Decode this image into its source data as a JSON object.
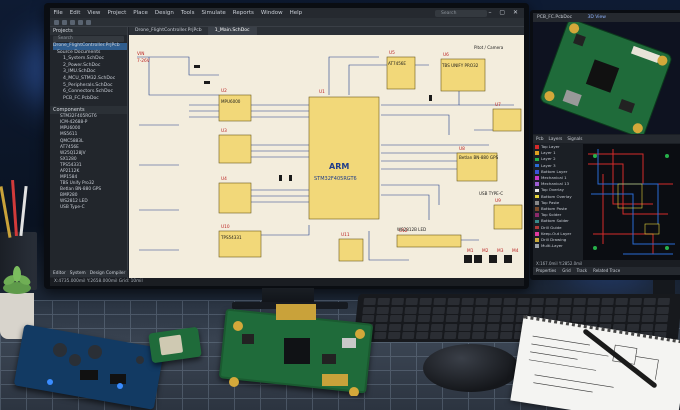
{
  "menu": [
    "File",
    "Edit",
    "View",
    "Project",
    "Place",
    "Design",
    "Tools",
    "Simulate",
    "Reports",
    "Window",
    "Help"
  ],
  "search": {
    "placeholder": "Search"
  },
  "doc_tabs": [
    "Drone_FlightController.PrjPcb",
    "1_Main.SchDoc"
  ],
  "projects_panel": {
    "title": "Projects",
    "search_placeholder": "Search",
    "tree": [
      "Drone_FlightController.PrjPcb",
      "Source Documents",
      "1_System.SchDoc",
      "2_Power.SchDoc",
      "3_IMU.SchDoc",
      "4_MCU_STM32.SchDoc",
      "5_Peripherals.SchDoc",
      "6_Connectors.SchDoc",
      "PCB_FC.PcbDoc"
    ]
  },
  "components_panel": {
    "title": "Components",
    "items": [
      "STM32F405RGT6",
      "ICM-42688-P",
      "MPU6000",
      "MS5611",
      "QMC5883L",
      "AT7456E",
      "W25Q128JV",
      "SX1280",
      "TPS54331",
      "AP2112K",
      "MP1584",
      "TBS Unify Pro32",
      "Betlan BN-880 GPS",
      "BMP280",
      "WS2812 LED",
      "USB Type-C"
    ]
  },
  "panel_tabs": [
    "Editor",
    "System",
    "Design Compiler"
  ],
  "statusbar": "X:4735.000mil Y:2658.000mil   Grid: 10mil",
  "schematic": {
    "main_ic": {
      "ref": "U1",
      "brand": "ARM",
      "part": "STM32F405RGT6"
    },
    "vin": "VIN",
    "vin_voltage": "7-26V",
    "labels": [
      "U2",
      "U3",
      "U4",
      "U5",
      "U6",
      "U7",
      "U8",
      "U9",
      "U10",
      "U11",
      "U12",
      "AT7456E",
      "TBS UNIFY PRO32",
      "MPU6000",
      "Pitot / Camera",
      "Betlan BN-880 GPS",
      "USB TYPE-C",
      "WS2812B LED",
      "TPS54331",
      "M1",
      "M2",
      "M3",
      "M4"
    ]
  },
  "monitor2": {
    "tabs": [
      "PCB_FC.PcbDoc",
      "3D View"
    ],
    "panel_tabs": [
      "Pcb",
      "Layers",
      "Signals"
    ],
    "layers": [
      {
        "name": "Top Layer",
        "color": "#d42a2a"
      },
      {
        "name": "Layer 1",
        "color": "#e0a020"
      },
      {
        "name": "Layer 2",
        "color": "#26b14a"
      },
      {
        "name": "Layer 3",
        "color": "#2a6ad4"
      },
      {
        "name": "Bottom Layer",
        "color": "#3a55d8"
      },
      {
        "name": "Mechanical 1",
        "color": "#c838c8"
      },
      {
        "name": "Mechanical 13",
        "color": "#9b5dd1"
      },
      {
        "name": "Top Overlay",
        "color": "#e8e8e8"
      },
      {
        "name": "Bottom Overlay",
        "color": "#e3d33a"
      },
      {
        "name": "Top Paste",
        "color": "#888888"
      },
      {
        "name": "Bottom Paste",
        "color": "#7a4a2a"
      },
      {
        "name": "Top Solder",
        "color": "#8a2a6a"
      },
      {
        "name": "Bottom Solder",
        "color": "#3a8a8a"
      },
      {
        "name": "Drill Guide",
        "color": "#b03a3a"
      },
      {
        "name": "Keep-Out Layer",
        "color": "#e03aa0"
      },
      {
        "name": "Drill Drawing",
        "color": "#c8a83a"
      },
      {
        "name": "Multi-Layer",
        "color": "#9aa0a8"
      }
    ],
    "status": "X:167.0mil Y:2852.0mil",
    "status_tabs": [
      "Properties",
      "Grid",
      "Track",
      "Related Trace"
    ]
  },
  "colors": {
    "sheet": "#f3eddd",
    "ic_fill": "#f2d879",
    "wire": "#1e3c8a",
    "pcb_green": "#1f6b3a",
    "selection": "#2f5d8e"
  }
}
